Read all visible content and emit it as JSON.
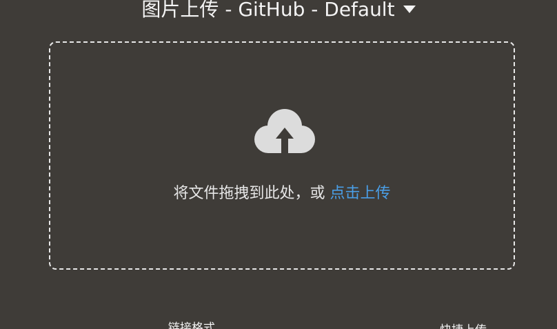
{
  "header": {
    "title": "图片上传 - GitHub - Default",
    "dropdown_icon": "caret-down-icon"
  },
  "dropzone": {
    "icon": "cloud-upload-icon",
    "text": "将文件拖拽到此处，或",
    "link_text": "点击上传"
  },
  "bottom": {
    "link_format_label": "链接格式",
    "quick_upload_label": "快捷上传"
  },
  "colors": {
    "background": "#3f3c38",
    "accent": "#4a9fe8",
    "icon": "#dcdcdc"
  }
}
